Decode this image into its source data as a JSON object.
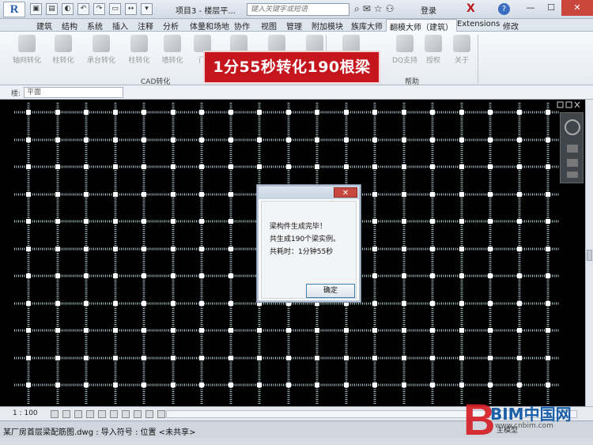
{
  "app": {
    "logo": "R",
    "title": "项目3 - 楼层平...",
    "search_placeholder": "键入关键字或短语",
    "login": "登录",
    "help": "?"
  },
  "tabs": [
    "建筑",
    "结构",
    "系统",
    "插入",
    "注释",
    "分析",
    "体量和场地",
    "协作",
    "视图",
    "管理",
    "附加模块",
    "族库大师",
    "翻模大师（建筑）",
    "Extensions",
    "修改"
  ],
  "active_tab": "翻模大师（建筑）",
  "ribbon": {
    "buttons": [
      "轴网转化",
      "柱转化",
      "承台转化",
      "柱转化",
      "墙转化",
      "门",
      "",
      "",
      "",
      "",
      "",
      "视频",
      "DQ支持",
      "授权",
      "关于"
    ],
    "groups": {
      "cad": "CAD转化",
      "help": "帮助"
    }
  },
  "banner": "1分55秒转化190根梁",
  "properties": {
    "label": "楼:",
    "view_select": "平面"
  },
  "dialog": {
    "close": "✕",
    "line1": "梁构件生成完毕！",
    "line2": "共生成190个梁实例。",
    "line3": "共耗时：1分钟55秒",
    "ok_label": "确定"
  },
  "statusbar": {
    "scale": "1 : 100"
  },
  "bottombar": {
    "text": "某厂房首层梁配筋图.dwg : 导入符号 : 位置 <未共享>",
    "model": "主模型"
  },
  "watermark": {
    "big": "B",
    "name": "BIM中国网",
    "url": "www.cnbim.com"
  },
  "colors": {
    "banner": "#c4161c",
    "canvas": "#000000",
    "grid": "#a9c3c9",
    "dialog_close": "#c8473e"
  }
}
